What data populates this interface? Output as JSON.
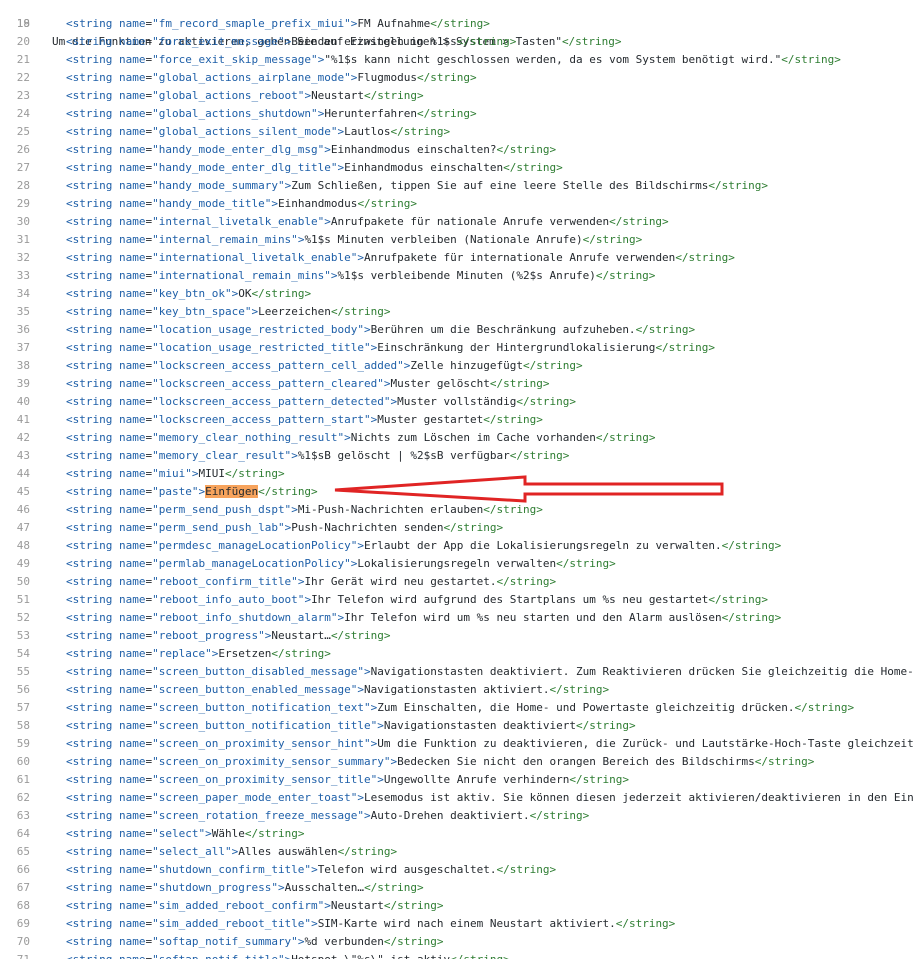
{
  "first_line": {
    "number": "18",
    "text": "Um die Funktion zu aktivieren, gehen Sie auf Einstellungen > System > Tasten\"",
    "close": "</string>"
  },
  "lines": [
    {
      "n": "19",
      "name": "fm_record_smaple_prefix_miui",
      "text": "FM Aufnahme"
    },
    {
      "n": "20",
      "name": "force_exit_message",
      "text": "Beenden erzwingen in %1$s"
    },
    {
      "n": "21",
      "name": "force_exit_skip_message",
      "text": "\"%1$s kann nicht geschlossen werden, da es vom System benötigt wird.\""
    },
    {
      "n": "22",
      "name": "global_actions_airplane_mode",
      "text": "Flugmodus"
    },
    {
      "n": "23",
      "name": "global_actions_reboot",
      "text": "Neustart"
    },
    {
      "n": "24",
      "name": "global_actions_shutdown",
      "text": "Herunterfahren"
    },
    {
      "n": "25",
      "name": "global_actions_silent_mode",
      "text": "Lautlos"
    },
    {
      "n": "26",
      "name": "handy_mode_enter_dlg_msg",
      "text": "Einhandmodus einschalten?"
    },
    {
      "n": "27",
      "name": "handy_mode_enter_dlg_title",
      "text": "Einhandmodus einschalten"
    },
    {
      "n": "28",
      "name": "handy_mode_summary",
      "text": "Zum Schließen, tippen Sie auf eine leere Stelle des Bildschirms"
    },
    {
      "n": "29",
      "name": "handy_mode_title",
      "text": "Einhandmodus"
    },
    {
      "n": "30",
      "name": "internal_livetalk_enable",
      "text": "Anrufpakete für nationale Anrufe verwenden"
    },
    {
      "n": "31",
      "name": "internal_remain_mins",
      "text": "%1$s Minuten verbleiben (Nationale Anrufe)"
    },
    {
      "n": "32",
      "name": "international_livetalk_enable",
      "text": "Anrufpakete für internationale Anrufe verwenden"
    },
    {
      "n": "33",
      "name": "international_remain_mins",
      "text": "%1$s verbleibende Minuten (%2$s Anrufe)"
    },
    {
      "n": "34",
      "name": "key_btn_ok",
      "text": "OK"
    },
    {
      "n": "35",
      "name": "key_btn_space",
      "text": "Leerzeichen"
    },
    {
      "n": "36",
      "name": "location_usage_restricted_body",
      "text": "Berühren um die Beschränkung aufzuheben."
    },
    {
      "n": "37",
      "name": "location_usage_restricted_title",
      "text": "Einschränkung der Hintergrundlokalisierung"
    },
    {
      "n": "38",
      "name": "lockscreen_access_pattern_cell_added",
      "text": "Zelle hinzugefügt"
    },
    {
      "n": "39",
      "name": "lockscreen_access_pattern_cleared",
      "text": "Muster gelöscht"
    },
    {
      "n": "40",
      "name": "lockscreen_access_pattern_detected",
      "text": "Muster vollständig"
    },
    {
      "n": "41",
      "name": "lockscreen_access_pattern_start",
      "text": "Muster gestartet"
    },
    {
      "n": "42",
      "name": "memory_clear_nothing_result",
      "text": "Nichts zum Löschen im Cache vorhanden"
    },
    {
      "n": "43",
      "name": "memory_clear_result",
      "text": "%1$sB gelöscht | %2$sB verfügbar"
    },
    {
      "n": "44",
      "name": "miui",
      "text": "MIUI"
    },
    {
      "n": "45",
      "name": "paste",
      "text": "Einfügen",
      "highlight": true
    },
    {
      "n": "46",
      "name": "perm_send_push_dspt",
      "text": "Mi-Push-Nachrichten erlauben"
    },
    {
      "n": "47",
      "name": "perm_send_push_lab",
      "text": "Push-Nachrichten senden"
    },
    {
      "n": "48",
      "name": "permdesc_manageLocationPolicy",
      "text": "Erlaubt der App die Lokalisierungsregeln zu verwalten."
    },
    {
      "n": "49",
      "name": "permlab_manageLocationPolicy",
      "text": "Lokalisierungsregeln verwalten"
    },
    {
      "n": "50",
      "name": "reboot_confirm_title",
      "text": "Ihr Gerät wird neu gestartet."
    },
    {
      "n": "51",
      "name": "reboot_info_auto_boot",
      "text": "Ihr Telefon wird aufgrund des Startplans um %s neu gestartet"
    },
    {
      "n": "52",
      "name": "reboot_info_shutdown_alarm",
      "text": "Ihr Telefon wird um %s neu starten und den Alarm auslösen"
    },
    {
      "n": "53",
      "name": "reboot_progress",
      "text": "Neustart…"
    },
    {
      "n": "54",
      "name": "replace",
      "text": "Ersetzen"
    },
    {
      "n": "55",
      "name": "screen_button_disabled_message",
      "text": "Navigationstasten deaktiviert. Zum Reaktivieren drücken Sie gleichzeitig die Home-",
      "truncated": true
    },
    {
      "n": "56",
      "name": "screen_button_enabled_message",
      "text": "Navigationstasten aktiviert."
    },
    {
      "n": "57",
      "name": "screen_button_notification_text",
      "text": "Zum Einschalten, die Home- und Powertaste gleichzeitig drücken."
    },
    {
      "n": "58",
      "name": "screen_button_notification_title",
      "text": "Navigationstasten deaktiviert"
    },
    {
      "n": "59",
      "name": "screen_on_proximity_sensor_hint",
      "text": "Um die Funktion zu deaktivieren, die Zurück- und Lautstärke-Hoch-Taste gleichzeit",
      "truncated": true
    },
    {
      "n": "60",
      "name": "screen_on_proximity_sensor_summary",
      "text": "Bedecken Sie nicht den orangen Bereich des Bildschirms"
    },
    {
      "n": "61",
      "name": "screen_on_proximity_sensor_title",
      "text": "Ungewollte Anrufe verhindern"
    },
    {
      "n": "62",
      "name": "screen_paper_mode_enter_toast",
      "text": "Lesemodus ist aktiv. Sie können diesen jederzeit aktivieren/deaktivieren in den Ein",
      "truncated": true
    },
    {
      "n": "63",
      "name": "screen_rotation_freeze_message",
      "text": "Auto-Drehen deaktiviert."
    },
    {
      "n": "64",
      "name": "select",
      "text": "Wähle"
    },
    {
      "n": "65",
      "name": "select_all",
      "text": "Alles auswählen"
    },
    {
      "n": "66",
      "name": "shutdown_confirm_title",
      "text": "Telefon wird ausgeschaltet."
    },
    {
      "n": "67",
      "name": "shutdown_progress",
      "text": "Ausschalten…"
    },
    {
      "n": "68",
      "name": "sim_added_reboot_confirm",
      "text": "Neustart"
    },
    {
      "n": "69",
      "name": "sim_added_reboot_title",
      "text": "SIM-Karte wird nach einem Neustart aktiviert."
    },
    {
      "n": "70",
      "name": "softap_notif_summary",
      "text": "%d verbunden"
    },
    {
      "n": "71",
      "name": "softap_notif_title",
      "text": "Hotspot \\\"%s\\\" ist aktiv",
      "partial": true
    }
  ],
  "annotation": {
    "arrow_color": "#e02424",
    "points_to_line": "45"
  },
  "colors": {
    "tag": "#1e5fa8",
    "close_tag": "#2e7d32",
    "highlight": "#f7a35c",
    "line_number": "#9a9a9a"
  }
}
